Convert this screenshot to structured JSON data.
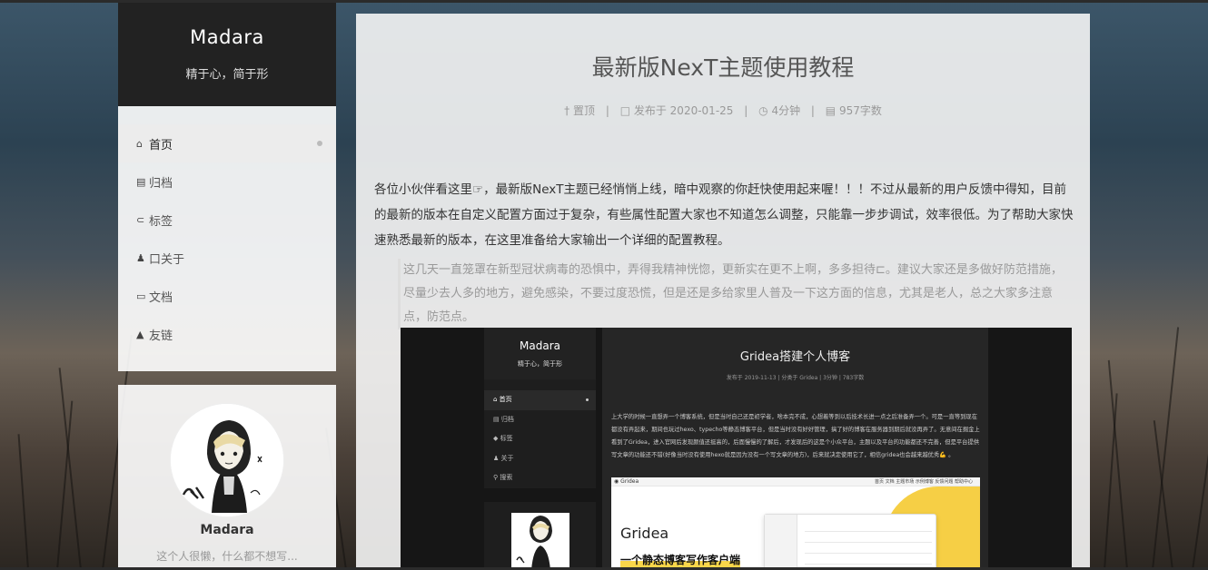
{
  "sidebar": {
    "site_title": "Madara",
    "site_subtitle": "精于心，简于形",
    "menu": [
      {
        "icon": "home-icon",
        "glyph": "⌂",
        "label": "首页",
        "active": true
      },
      {
        "icon": "archive-icon",
        "glyph": "▤",
        "label": "归档",
        "active": false
      },
      {
        "icon": "tags-icon",
        "glyph": "⊂",
        "label": "标签",
        "active": false
      },
      {
        "icon": "user-icon",
        "glyph": "♟",
        "label": "口关于",
        "active": false
      },
      {
        "icon": "book-icon",
        "glyph": "▭",
        "label": "文档",
        "active": false
      },
      {
        "icon": "link-icon",
        "glyph": "▲",
        "label": "友链",
        "active": false
      }
    ],
    "author": {
      "name": "Madara",
      "description": "这个人很懒，什么都不想写..."
    }
  },
  "post": {
    "title": "最新版NexT主题使用教程",
    "meta": {
      "pin": "置顶",
      "published": "发布于 2020-01-25",
      "read_time": "4分钟",
      "word_count": "957字数"
    },
    "paragraph": "各位小伙伴看这里☞，最新版NexT主题已经悄悄上线，暗中观察的你赶快使用起来喔！！！不过从最新的用户反馈中得知，目前的最新的版本在自定义配置方面过于复杂，有些属性配置大家也不知道怎么调整，只能靠一步步调试，效率很低。为了帮助大家快速熟悉最新的版本，在这里准备给大家输出一个详细的配置教程。",
    "quote": "这几天一直笼罩在新型冠状病毒的恐惧中，弄得我精神恍惚，更新实在更不上啊，多多担待⊏。建议大家还是多做好防范措施，尽量少去人多的地方，避免感染，不要过度恐慌，但是还是多给家里人普及一下这方面的信息，尤其是老人，总之大家多注意点，防范点。"
  },
  "embedded_screenshot": {
    "site_title": "Madara",
    "site_subtitle": "精于心，简于形",
    "menu": [
      "首页",
      "归档",
      "标签",
      "关于",
      "搜索"
    ],
    "post_title": "Gridea搭建个人博客",
    "post_meta": "发布于 2019-11-13  |  分类于 Gridea  |  3分钟  |  783字数",
    "post_body": "上大学的时候一直想弄一个博客系统，但是当时自己还是初学者，啥本完不成，心想着等到以后技术长进一点之后准备弄一个。可是一直等到现在都没有弄起来，期间也玩过hexo、typecho等静态博客平台，但是当时没有好好管理，搞了好的博客在服务器到期后就没再弄了。无意间在掘金上看到了Gridea，进入官网后发现颜值还挺高的，后面慢慢的了解后，才发现后的这是个小众平台，主题以及平台的功能都还不完善，但是平台提供写文章的功能还不错(好像当时没有使用hexo就是因为没有一个写文章的地方)，后来就决定使用它了，相信gridea也会越来越优秀💪 。",
    "app_name": "Gridea",
    "app_heading": "Gridea",
    "app_tagline": "一个静态博客写作客户端",
    "app_nav": "首页  文档  主题市场  示例博客  反馈问题  帮助中心"
  }
}
